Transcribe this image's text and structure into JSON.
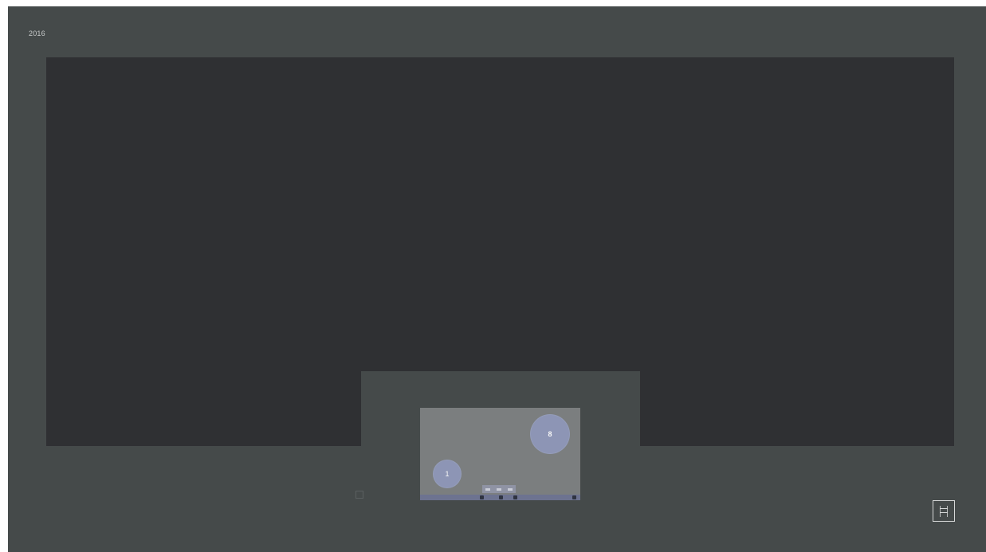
{
  "header": {
    "label": "2016"
  },
  "preview": {
    "badge_left": "1",
    "badge_right": "8"
  },
  "icons": {
    "corner_button_icon": "document-icon",
    "left_small_square_icon": "square-icon"
  },
  "colors": {
    "background": "#454a4a",
    "canvas": "#2f3033",
    "preview": "#7b7e7f",
    "accent": "#8e97b8",
    "border": "#d6d8d8"
  }
}
